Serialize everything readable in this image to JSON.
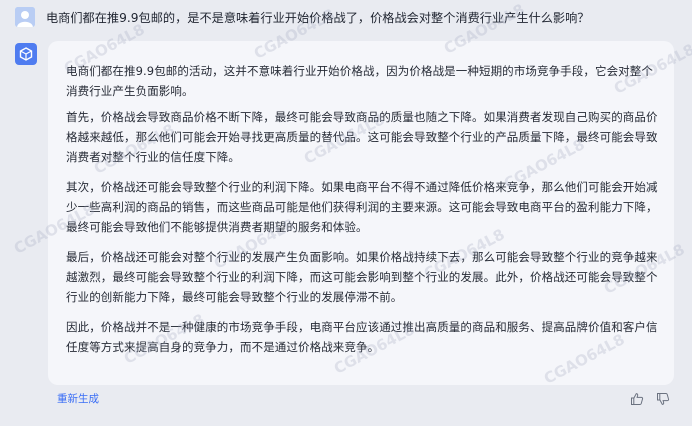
{
  "conversation": {
    "question": "电商们都在推9.9包邮的，是不是意味着行业开始价格战了，价格战会对整个消费行业产生什么影响？",
    "answer_paragraphs": [
      "电商们都在推9.9包邮的活动，这并不意味着行业开始价格战，因为价格战是一种短期的市场竞争手段，它会对整个消费行业产生负面影响。",
      "首先，价格战会导致商品价格不断下降，最终可能会导致商品的质量也随之下降。如果消费者发现自己购买的商品价格越来越低，那么他们可能会开始寻找更高质量的替代品。这可能会导致整个行业的产品质量下降，最终可能会导致消费者对整个行业的信任度下降。",
      "其次，价格战还可能会导致整个行业的利润下降。如果电商平台不得不通过降低价格来竞争，那么他们可能会开始减少一些高利润的商品的销售，而这些商品可能是他们获得利润的主要来源。这可能会导致电商平台的盈利能力下降，最终可能会导致他们不能够提供消费者期望的服务和体验。",
      "最后，价格战还可能会对整个行业的发展产生负面影响。如果价格战持续下去，那么可能会导致整个行业的竞争越来越激烈，最终可能会导致整个行业的利润下降，而这可能会影响到整个行业的发展。此外，价格战还可能会导致整个行业的创新能力下降，最终可能会导致整个行业的发展停滞不前。",
      "因此，价格战并不是一种健康的市场竞争手段，电商平台应该通过推出高质量的商品和服务、提高品牌价值和客户信任度等方式来提高自身的竞争力，而不是通过价格战来竞争。"
    ]
  },
  "footer": {
    "regenerate_label": "重新生成"
  },
  "watermark_text": "CGAO64L8",
  "icons": {
    "user_avatar": "user-avatar-icon",
    "bot_avatar": "bot-cube-icon",
    "thumbs_up": "thumbs-up-icon",
    "thumbs_down": "thumbs-down-icon"
  },
  "colors": {
    "page_bg": "#e9ebf1",
    "card_bg": "#f5f6fa",
    "accent": "#3b6ef5",
    "bot_avatar": "#4f7cf0"
  }
}
